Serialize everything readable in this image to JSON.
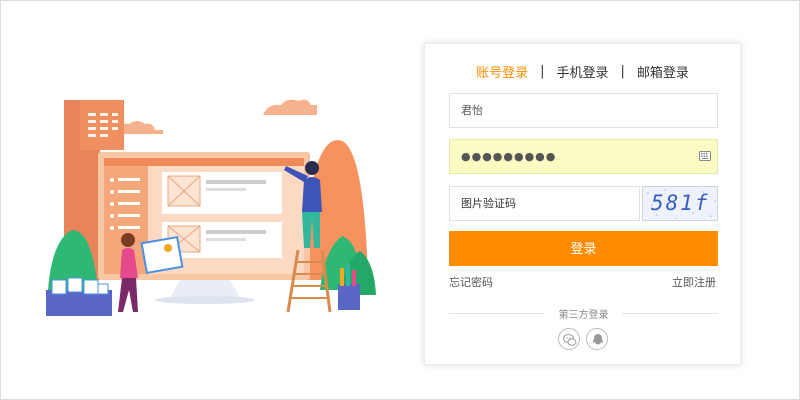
{
  "tabs": {
    "account": "账号登录",
    "phone": "手机登录",
    "email": "邮箱登录",
    "separator": "|"
  },
  "form": {
    "username_value": "君怡",
    "password_value": "●●●●●●●●●",
    "captcha_placeholder": "图片验证码",
    "captcha_code": "581f"
  },
  "actions": {
    "login_label": "登录",
    "forgot_label": "忘记密码",
    "register_label": "立即注册"
  },
  "third_party": {
    "label": "第三方登录",
    "providers": [
      "wechat-icon",
      "qq-icon"
    ]
  },
  "colors": {
    "accent": "#ff8c00",
    "autofill": "#fafcc4"
  }
}
